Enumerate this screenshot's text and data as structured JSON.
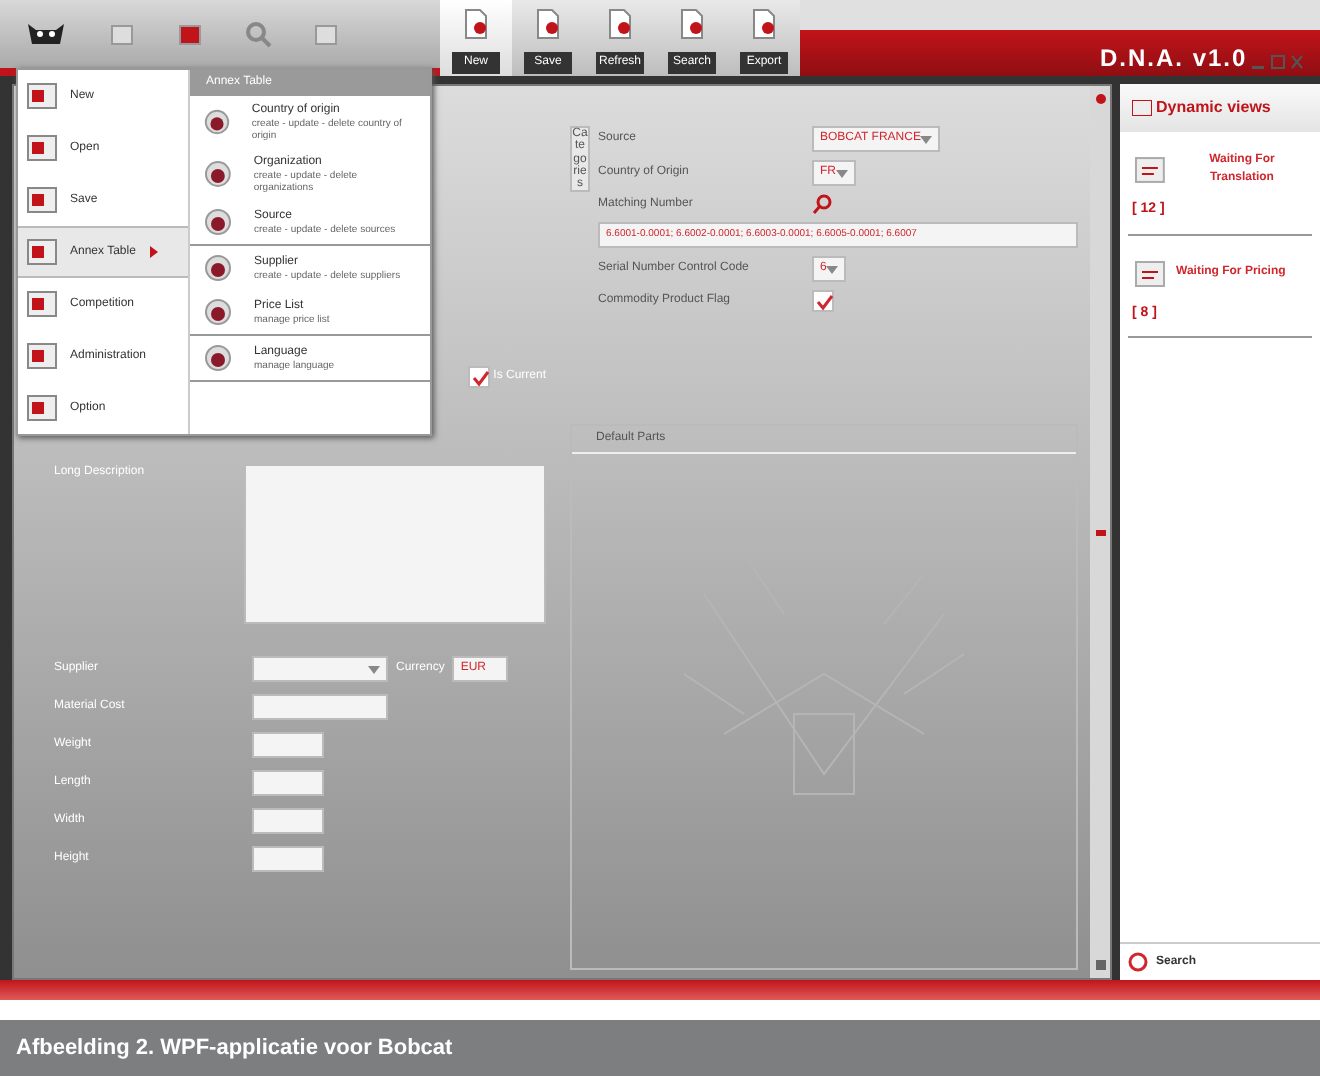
{
  "toolbar": {
    "tabs": [
      {
        "label": "New",
        "selected": true
      },
      {
        "label": "Save",
        "selected": false
      },
      {
        "label": "Refresh",
        "selected": false
      },
      {
        "label": "Search",
        "selected": false
      },
      {
        "label": "Export",
        "selected": false
      }
    ],
    "title": "D.N.A. v1.0"
  },
  "app_menu": {
    "items": [
      {
        "label": "New",
        "selected": false
      },
      {
        "label": "Open",
        "selected": false
      },
      {
        "label": "Save",
        "selected": false
      },
      {
        "label": "Annex Table",
        "selected": true
      },
      {
        "label": "Competition",
        "selected": false
      },
      {
        "label": "Administration",
        "selected": false
      },
      {
        "label": "Option",
        "selected": false
      }
    ],
    "submenu": {
      "title": "Annex Table",
      "groups": [
        [
          {
            "title": "Country of origin",
            "description": "create - update - delete country of origin"
          },
          {
            "title": "Organization",
            "description": "create - update - delete organizations"
          },
          {
            "title": "Source",
            "description": "create - update - delete sources"
          }
        ],
        [
          {
            "title": "Supplier",
            "description": "create - update - delete suppliers"
          },
          {
            "title": "Price List",
            "description": "manage price list"
          }
        ],
        [
          {
            "title": "Language",
            "description": "manage language"
          }
        ]
      ]
    }
  },
  "form": {
    "is_current": {
      "label": "Is Current",
      "checked": true
    },
    "long_description": {
      "label": "Long Description"
    },
    "rows": [
      {
        "label": "Supplier",
        "kind": "select",
        "extra": {
          "label": "Currency",
          "value": "EUR"
        }
      },
      {
        "label": "Material Cost",
        "kind": "text"
      },
      {
        "label": "Weight",
        "kind": "short"
      },
      {
        "label": "Length",
        "kind": "short"
      },
      {
        "label": "Width",
        "kind": "short"
      },
      {
        "label": "Height",
        "kind": "short"
      }
    ]
  },
  "details": {
    "vertical_tab": "Categories",
    "fields": [
      {
        "label": "Source",
        "kind": "select",
        "value": "BOBCAT FRANCE"
      },
      {
        "label": "Country of Origin",
        "kind": "select",
        "value": "FR"
      },
      {
        "label": "Matching Number",
        "kind": "lookup"
      },
      {
        "kind": "code",
        "value": "6.6001-0.0001; 6.6002-0.0001; 6.6003-0.0001; 6.6005-0.0001; 6.6007"
      },
      {
        "label": "Serial Number Control Code",
        "kind": "select",
        "value": "6"
      },
      {
        "label": "Commodity Product Flag",
        "kind": "check",
        "checked": true
      }
    ],
    "default_parts": {
      "title": "Default Parts"
    }
  },
  "dynamic_views": {
    "title": "Dynamic views",
    "items": [
      {
        "label": "Waiting For Translation",
        "count": "[ 12 ]"
      },
      {
        "label": "Waiting For Pricing",
        "count": "[ 8 ]"
      }
    ],
    "search": "Search"
  },
  "caption": "Afbeelding 2. WPF-applicatie voor Bobcat"
}
